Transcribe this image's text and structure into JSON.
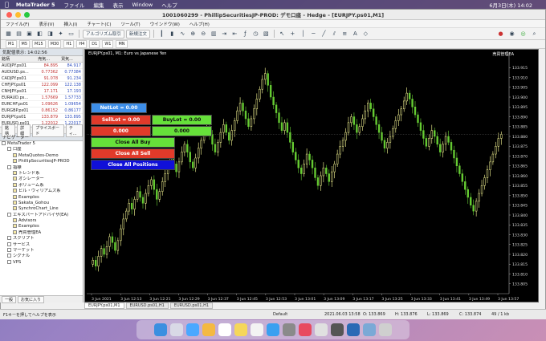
{
  "os_menu": {
    "app": "MetaTrader 5",
    "items": [
      "ファイル",
      "編集",
      "表示",
      "Window",
      "ヘルプ"
    ],
    "clock": "6月3日(木)  14:02"
  },
  "window": {
    "title": "1001060299 - PhillipSecuritiesJP-PROD: デモ口座 - Hedge - [EURJPY.ps01,M1]"
  },
  "menu": [
    "ファイル(F)",
    "表示(V)",
    "挿入(I)",
    "チャート(C)",
    "ツール(T)",
    "ウインドウ(W)",
    "ヘルプ(H)"
  ],
  "toolbar": {
    "algo_label": "アルゴリズム取引",
    "neworder_label": "新規注文"
  },
  "timeframes": [
    "M1",
    "M5",
    "M15",
    "M30",
    "H1",
    "H4",
    "D1",
    "W1",
    "MN"
  ],
  "market_watch": {
    "title": "気配値表示: 14:02:56",
    "columns": [
      "銘柄",
      "売気...",
      "買気..."
    ],
    "rows": [
      {
        "symbol": "AUDJPY.ps01",
        "bid": "84.895",
        "ask": "84.917"
      },
      {
        "symbol": "AUDUSD.ps...",
        "bid": "0.77362",
        "ask": "0.77384"
      },
      {
        "symbol": "CADJPY.ps01",
        "bid": "91.078",
        "ask": "91.234"
      },
      {
        "symbol": "CHFJPY.ps01",
        "bid": "122.099",
        "ask": "122.138"
      },
      {
        "symbol": "CNHJPY.ps01",
        "bid": "17.171",
        "ask": "17.193"
      },
      {
        "symbol": "EURAUD.ps...",
        "bid": "1.57669",
        "ask": "1.57733"
      },
      {
        "symbol": "EURCHF.ps01",
        "bid": "1.09626",
        "ask": "1.09654"
      },
      {
        "symbol": "EURGBP.ps01",
        "bid": "0.86152",
        "ask": "0.86177"
      },
      {
        "symbol": "EURJPY.ps01",
        "bid": "133.879",
        "ask": "133.895"
      },
      {
        "symbol": "EURUSD.ps01",
        "bid": "1.22012",
        "ask": "1.22017"
      }
    ],
    "tabs": [
      "銘柄",
      "詳細",
      "プライスボード",
      "ティ..."
    ]
  },
  "navigator": {
    "title": "ナビゲーター",
    "items": [
      {
        "label": "MetaTrader 5",
        "level": 0
      },
      {
        "label": "口座",
        "level": 1
      },
      {
        "label": "MetaQuotes-Demo",
        "level": 2
      },
      {
        "label": "PhillipSecuritiesJP-PROD",
        "level": 2
      },
      {
        "label": "指標",
        "level": 1
      },
      {
        "label": "トレンド系",
        "level": 2
      },
      {
        "label": "オシレーター",
        "level": 2
      },
      {
        "label": "ボリューム系",
        "level": 2
      },
      {
        "label": "ビル・ウィリアムズ系",
        "level": 2
      },
      {
        "label": "Examples",
        "level": 2
      },
      {
        "label": "Sakata_Gohou",
        "level": 2
      },
      {
        "label": "SynchroChart_Line",
        "level": 2
      },
      {
        "label": "エキスパートアドバイザ(EA)",
        "level": 1
      },
      {
        "label": "Advisors",
        "level": 2
      },
      {
        "label": "Examples",
        "level": 2
      },
      {
        "label": "売買管理EA",
        "level": 2
      },
      {
        "label": "スクリプト",
        "level": 1
      },
      {
        "label": "サービス",
        "level": 1
      },
      {
        "label": "マーケット",
        "level": 1
      },
      {
        "label": "シグナル",
        "level": 1
      },
      {
        "label": "VPS",
        "level": 1
      }
    ],
    "tabs": [
      "一般",
      "お気に入り"
    ]
  },
  "chart": {
    "title": "EURJPY.ps01, M1:  Euro vs Japanese Yen",
    "ea_label": "売買管理EA",
    "tabs": [
      "EURJPY.ps01,M1",
      "EURUSD.ps01,H1",
      "EURUSD.ps01,H1"
    ]
  },
  "ea_panel": {
    "netlot": "NetLot = 0.00",
    "selllot": "SellLot = 0.00",
    "buylot": "BuyLot = 0.00",
    "sell_value": "0.000",
    "buy_value": "0.000",
    "close_buy": "Close All Buy",
    "close_sell": "Close All Sell",
    "close_all": "Close All Positions"
  },
  "chart_data": {
    "type": "candlestick",
    "symbol": "EURJPY.ps01",
    "timeframe": "M1",
    "ylim": [
      133.8,
      133.92
    ],
    "yticks": [
      "133.915",
      "133.910",
      "133.905",
      "133.900",
      "133.895",
      "133.890",
      "133.885",
      "133.880",
      "133.875",
      "133.870",
      "133.865",
      "133.860",
      "133.855",
      "133.850",
      "133.845",
      "133.840",
      "133.835",
      "133.830",
      "133.825",
      "133.820",
      "133.815",
      "133.810",
      "133.805"
    ],
    "xticks": [
      "3 Jun 2021",
      "3 Jun 12:13",
      "3 Jun 12:21",
      "3 Jun 12:29",
      "3 Jun 12:37",
      "3 Jun 12:45",
      "3 Jun 12:53",
      "3 Jun 13:01",
      "3 Jun 13:09",
      "3 Jun 13:17",
      "3 Jun 13:25",
      "3 Jun 13:33",
      "3 Jun 13:41",
      "3 Jun 13:49",
      "3 Jun 13:57"
    ],
    "close": [
      133.817,
      133.814,
      133.819,
      133.823,
      133.82,
      133.824,
      133.829,
      133.826,
      133.822,
      133.827,
      133.833,
      133.838,
      133.842,
      133.846,
      133.843,
      133.848,
      133.852,
      133.849,
      133.846,
      133.851,
      133.855,
      133.858,
      133.853,
      133.848,
      133.852,
      133.857,
      133.861,
      133.866,
      133.87,
      133.866,
      133.862,
      133.867,
      133.872,
      133.876,
      133.872,
      133.867,
      133.864,
      133.869,
      133.874,
      133.878,
      133.882,
      133.885,
      133.881,
      133.876,
      133.872,
      133.877,
      133.882,
      133.886,
      133.882,
      133.878,
      133.883,
      133.888,
      133.893,
      133.897,
      133.893,
      133.889,
      133.885,
      133.889,
      133.894,
      133.899,
      133.904,
      133.909,
      133.912,
      133.906,
      133.9,
      133.896,
      133.892,
      133.887,
      133.883,
      133.887,
      133.882,
      133.877,
      133.872,
      133.868,
      133.864,
      133.861,
      133.866,
      133.871,
      133.868,
      133.864,
      133.859,
      133.855,
      133.86,
      133.864,
      133.861,
      133.857,
      133.862,
      133.866,
      133.871,
      133.875,
      133.878,
      133.882,
      133.887,
      133.89,
      133.886,
      133.882,
      133.885,
      133.889,
      133.893,
      133.897,
      133.894,
      133.89,
      133.886,
      133.882,
      133.878,
      133.874,
      133.877,
      133.88,
      133.884,
      133.888,
      133.891,
      133.894,
      133.898,
      133.902,
      133.899,
      133.895,
      133.891,
      133.887,
      133.883,
      133.879,
      133.875,
      133.879,
      133.883,
      133.88,
      133.876,
      133.872,
      133.876,
      133.88,
      133.877,
      133.873,
      133.869,
      133.865,
      133.861,
      133.857,
      133.853,
      133.849,
      133.845,
      133.842,
      133.847,
      133.851,
      133.855,
      133.859,
      133.863,
      133.867,
      133.871,
      133.875,
      133.879,
      133.881
    ]
  },
  "status": {
    "help": "F1キーを押してヘルプを表示",
    "profile": "Default",
    "datetime": "2021.06.03 13:58",
    "open": "O: 133.869",
    "high": "H: 133.876",
    "low": "L: 133.869",
    "close": "C: 133.874",
    "traffic": "49 / 1 kb"
  },
  "colors": {
    "bull": "#ffff99",
    "bear": "#66cc33",
    "panel_blue": "#3d8ee8",
    "panel_red": "#e03a2a",
    "panel_green": "#66e03a",
    "panel_darkblue": "#1010d8"
  }
}
